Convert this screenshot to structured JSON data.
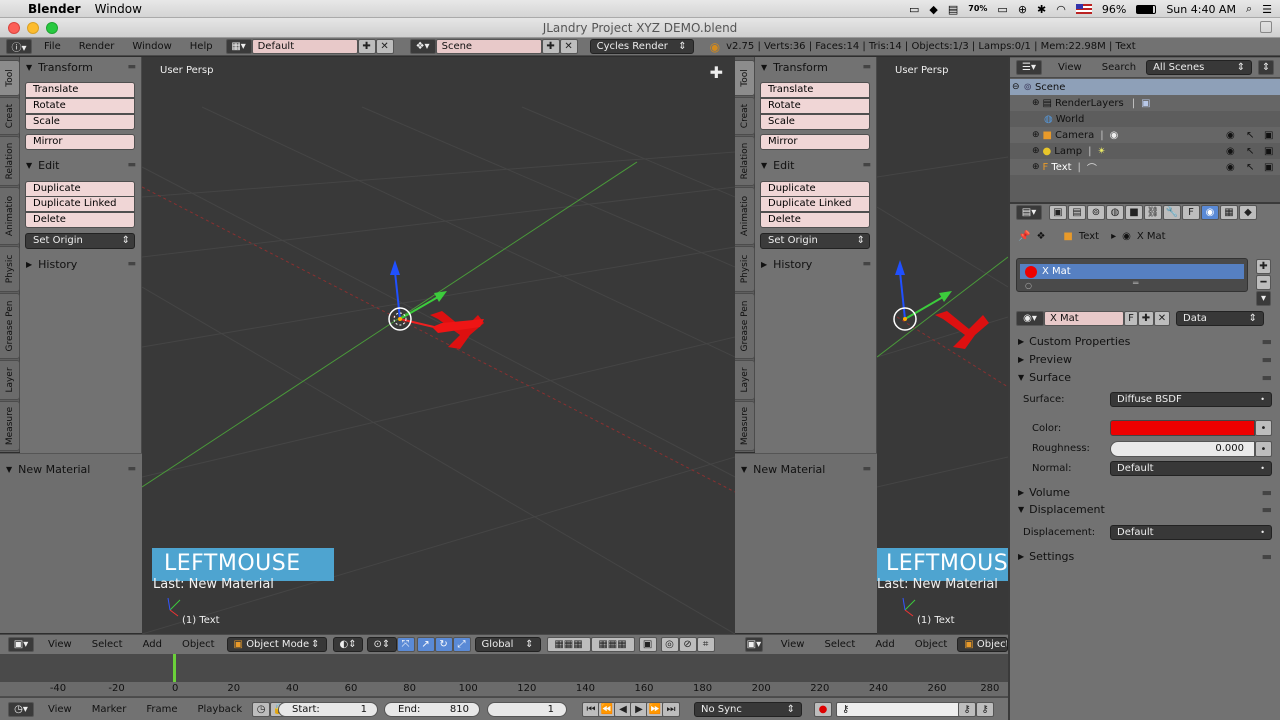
{
  "macbar": {
    "apple": "",
    "app": "Blender",
    "menu": "Window",
    "battery_small": "70%",
    "battery": "96%",
    "clock": "Sun 4:40 AM"
  },
  "window": {
    "title": "JLandry Project XYZ DEMO.blend"
  },
  "info": {
    "menus": [
      "File",
      "Render",
      "Window",
      "Help"
    ],
    "layout": "Default",
    "scene": "Scene",
    "engine": "Cycles Render",
    "stats": "v2.75 | Verts:36 | Faces:14 | Tris:14 | Objects:1/3 | Lamps:0/1 | Mem:22.98M | Text"
  },
  "tabs": [
    "Tool",
    "Creat",
    "Relation",
    "Animatio",
    "Physic",
    "Grease Pen",
    "Layer",
    "Measure"
  ],
  "toolshelf": {
    "transform": "Transform",
    "translate": "Translate",
    "rotate": "Rotate",
    "scale": "Scale",
    "mirror": "Mirror",
    "edit": "Edit",
    "duplicate": "Duplicate",
    "duplicate_linked": "Duplicate Linked",
    "delete": "Delete",
    "set_origin": "Set Origin",
    "history": "History",
    "new_material": "New Material"
  },
  "viewport": {
    "label": "User Persp",
    "key": "LEFTMOUSE",
    "last_op": "Last: New Material",
    "object": "(1) Text"
  },
  "view3d_header": {
    "menus": [
      "View",
      "Select",
      "Add",
      "Object"
    ],
    "mode": "Object Mode",
    "orientation": "Global",
    "mode_short": "Object M"
  },
  "outliner": {
    "menus": [
      "View",
      "Search"
    ],
    "filter": "All Scenes",
    "items": [
      "Scene",
      "RenderLayers",
      "World",
      "Camera",
      "Lamp",
      "Text"
    ]
  },
  "properties": {
    "breadcrumb": [
      "Text",
      "X Mat"
    ],
    "slot": "X Mat",
    "material_name": "X Mat",
    "link": "Data",
    "sections": {
      "custom": "Custom Properties",
      "preview": "Preview",
      "surface": "Surface",
      "volume": "Volume",
      "displacement": "Displacement",
      "settings": "Settings"
    },
    "surface_label": "Surface:",
    "surface_value": "Diffuse BSDF",
    "color_label": "Color:",
    "color_value": "#ee0000",
    "roughness_label": "Roughness:",
    "roughness_value": "0.000",
    "normal_label": "Normal:",
    "normal_value": "Default",
    "displacement_label": "Displacement:",
    "displacement_value": "Default"
  },
  "timeline": {
    "ticks": [
      "-40",
      "-20",
      "0",
      "20",
      "40",
      "60",
      "80",
      "100",
      "120",
      "140",
      "160",
      "180",
      "200",
      "220",
      "240",
      "260",
      "280"
    ],
    "menus": [
      "View",
      "Marker",
      "Frame",
      "Playback"
    ],
    "start_label": "Start:",
    "start_value": "1",
    "end_label": "End:",
    "end_value": "810",
    "current": "1",
    "sync": "No Sync"
  }
}
